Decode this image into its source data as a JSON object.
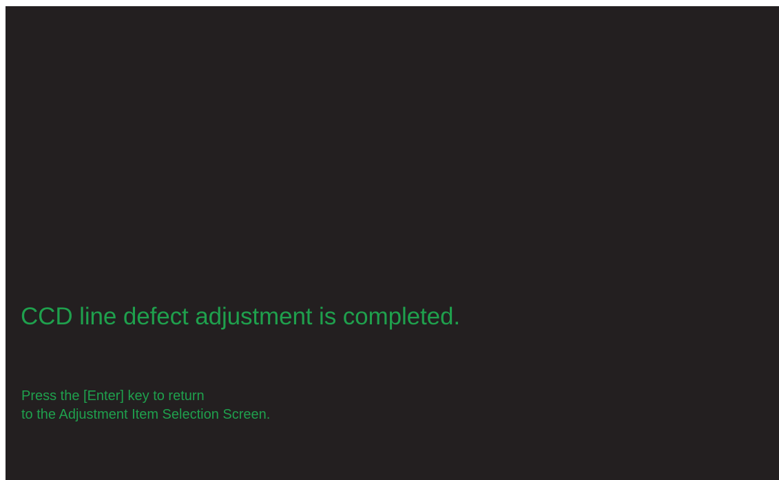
{
  "screen": {
    "message": "CCD line defect adjustment is completed.",
    "instruction_lines": [
      "Press the [Enter] key to return",
      "to the Adjustment Item Selection Screen."
    ]
  },
  "colors": {
    "background": "#231f20",
    "text": "#1fa04d"
  }
}
